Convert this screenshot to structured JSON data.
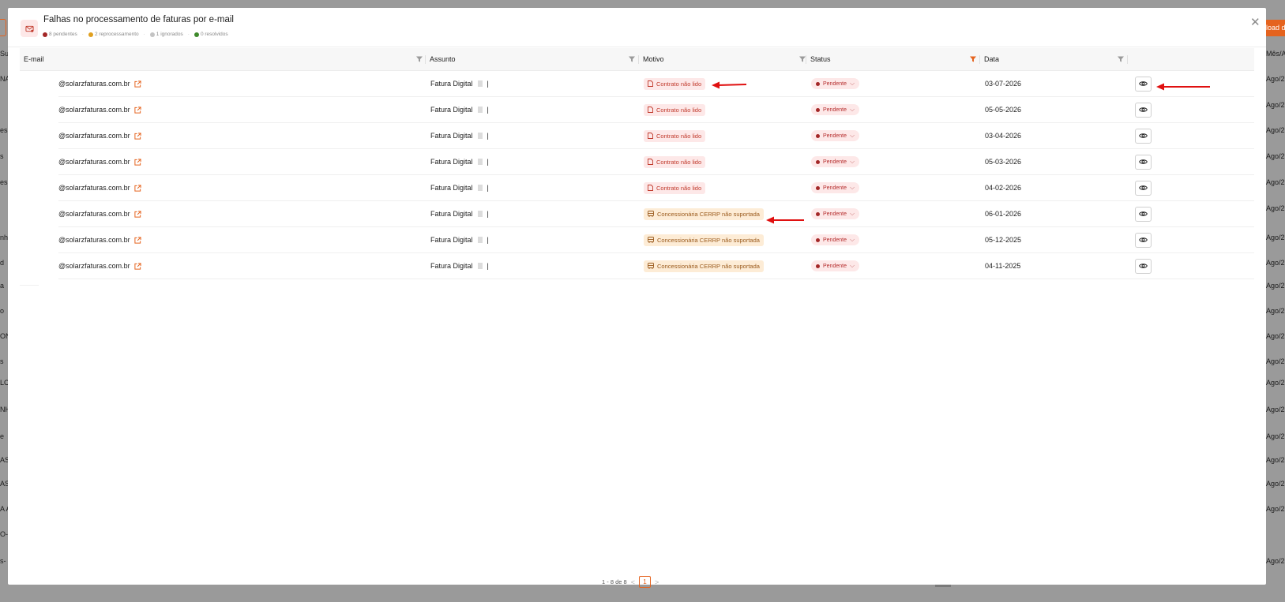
{
  "background": {
    "left_fragments": [
      "Sur",
      "NA",
      "es",
      "s",
      "es",
      "nh",
      "d",
      "a",
      "o",
      "ON",
      "s",
      "LC",
      "NH",
      "e",
      "AS",
      "AS",
      "A A",
      "O-C",
      "s-"
    ],
    "right_header": "Mês/A",
    "right_button": "load d",
    "right_values": [
      "Ago/2",
      "Ago/2",
      "Ago/2",
      "Ago/2",
      "Ago/2",
      "Ago/2",
      "Ago/2",
      "Ago/2",
      "Ago/2",
      "Ago/2",
      "Ago/2",
      "Ago/2",
      "Ago/2",
      "Ago/2",
      "Ago/2",
      "Ago/2",
      "Ago/2",
      "Ago/2",
      "Ago/2"
    ]
  },
  "modal": {
    "title": "Falhas no processamento de faturas por e-mail",
    "header_icon": "mail-alert-icon",
    "close_icon": "close-icon",
    "summary": [
      {
        "text": "8 pendentes",
        "color": "#a32727"
      },
      {
        "text": "2 reprocessamento",
        "color": "#e0a020"
      },
      {
        "text": "1 ignorados",
        "color": "#c4c4c4"
      },
      {
        "text": "0 resolvidos",
        "color": "#3f8a2c"
      }
    ],
    "separator": "·"
  },
  "table": {
    "columns": [
      {
        "label": "E-mail",
        "filtered": false
      },
      {
        "label": "Assunto",
        "filtered": false
      },
      {
        "label": "Motivo",
        "filtered": false
      },
      {
        "label": "Status",
        "filtered": true
      },
      {
        "label": "Data",
        "filtered": false
      }
    ],
    "rows": [
      {
        "email": "@solarzfaturas.com.br",
        "subject": "Fatura Digital",
        "subject_suffix": "|",
        "reason": "Contrato não lido",
        "reason_type": "red",
        "status": "Pendente",
        "date": "03-07-2026"
      },
      {
        "email": "@solarzfaturas.com.br",
        "subject": "Fatura Digital",
        "subject_suffix": "|",
        "reason": "Contrato não lido",
        "reason_type": "red",
        "status": "Pendente",
        "date": "05-05-2026"
      },
      {
        "email": "@solarzfaturas.com.br",
        "subject": "Fatura Digital",
        "subject_suffix": "|",
        "reason": "Contrato não lido",
        "reason_type": "red",
        "status": "Pendente",
        "date": "03-04-2026"
      },
      {
        "email": "@solarzfaturas.com.br",
        "subject": "Fatura Digital",
        "subject_suffix": "|",
        "reason": "Contrato não lido",
        "reason_type": "red",
        "status": "Pendente",
        "date": "05-03-2026"
      },
      {
        "email": "@solarzfaturas.com.br",
        "subject": "Fatura Digital",
        "subject_suffix": "|",
        "reason": "Contrato não lido",
        "reason_type": "red",
        "status": "Pendente",
        "date": "04-02-2026"
      },
      {
        "email": "@solarzfaturas.com.br",
        "subject": "Fatura Digital",
        "subject_suffix": "|",
        "reason": "Concessionária CERRP não suportada",
        "reason_type": "orange",
        "status": "Pendente",
        "date": "06-01-2026"
      },
      {
        "email": "@solarzfaturas.com.br",
        "subject": "Fatura Digital",
        "subject_suffix": "|",
        "reason": "Concessionária CERRP não suportada",
        "reason_type": "orange",
        "status": "Pendente",
        "date": "05-12-2025"
      },
      {
        "email": "@solarzfaturas.com.br",
        "subject": "Fatura Digital",
        "subject_suffix": "|",
        "reason": "Concessionária CERRP não suportada",
        "reason_type": "orange",
        "status": "Pendente",
        "date": "04-11-2025"
      }
    ]
  },
  "pagination": {
    "range_text": "1 - 8 de 8",
    "current_page": "1",
    "prev_label": "<",
    "next_label": ">"
  },
  "colors": {
    "accent": "#e5631e",
    "pending": "#a32727",
    "annotation_arrow": "#e01010"
  }
}
